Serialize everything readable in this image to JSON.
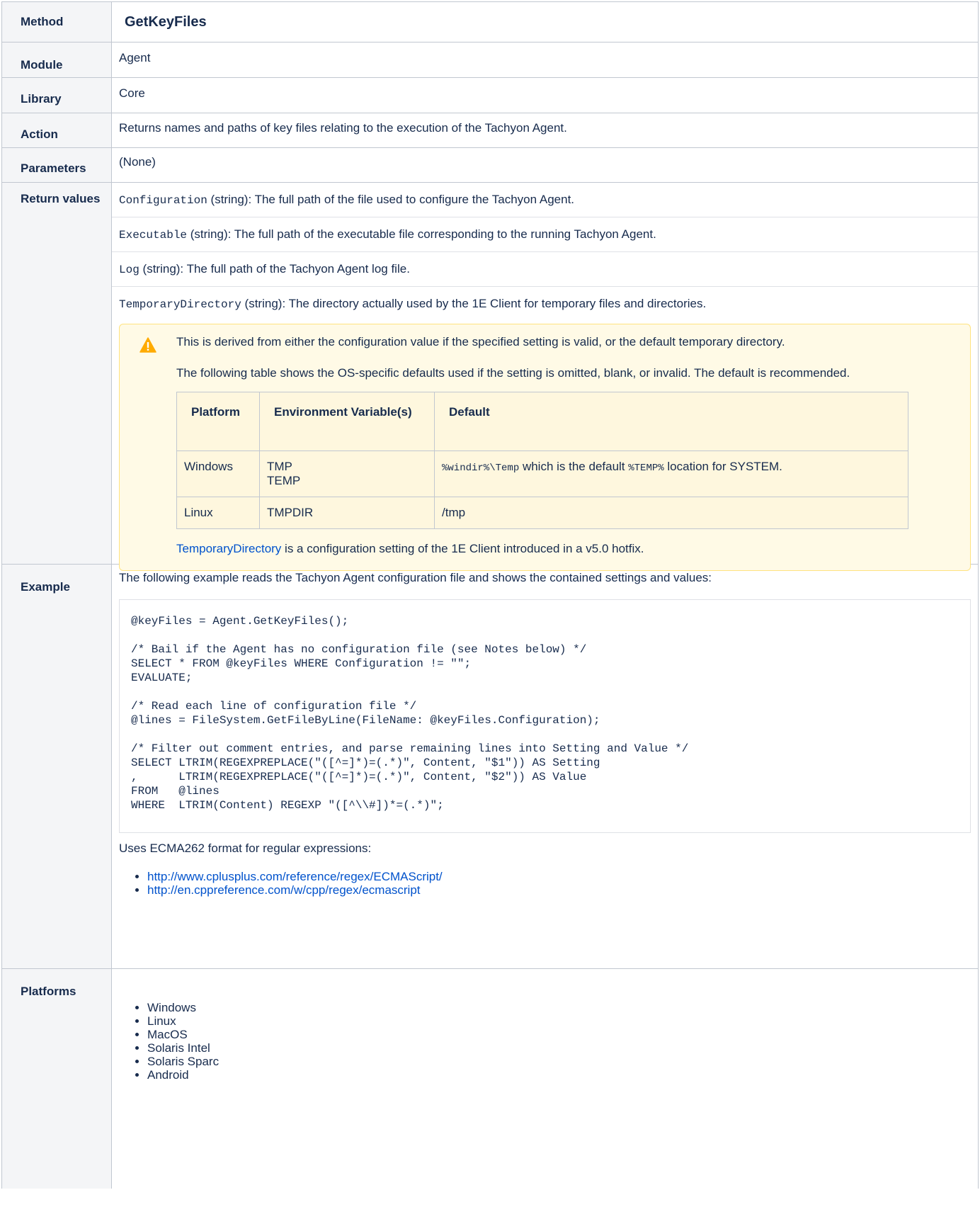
{
  "method": {
    "label": "Method",
    "value": "GetKeyFiles"
  },
  "module": {
    "label": "Module",
    "value": "Agent"
  },
  "library": {
    "label": "Library",
    "value": "Core"
  },
  "action": {
    "label": "Action",
    "value": "Returns names and paths of key files relating to the execution of the Tachyon Agent."
  },
  "parameters": {
    "label": "Parameters",
    "value": "(None)"
  },
  "return_values": {
    "label": "Return values",
    "items": [
      {
        "name": "Configuration",
        "desc": " (string): The full path of the file used to configure the Tachyon Agent."
      },
      {
        "name": "Executable",
        "desc": " (string): The full path of the executable file corresponding to the running Tachyon Agent."
      },
      {
        "name": "Log",
        "desc": " (string): The full path of the Tachyon Agent log file."
      },
      {
        "name": "TemporaryDirectory",
        "desc": " (string): The directory actually used by the 1E Client for temporary files and directories."
      }
    ],
    "warning": {
      "line1": "This is derived from either the configuration value if the specified setting is valid, or the default temporary directory.",
      "line2": "The following table shows the OS-specific defaults used if the setting is omitted, blank, or invalid. The default is recommended.",
      "table_headers": [
        "Platform",
        "Environment Variable(s)",
        "Default"
      ],
      "rows": [
        {
          "platform": "Windows",
          "env1": "TMP",
          "env2": "TEMP",
          "def_code1": "%windir%\\Temp",
          "def_text1": " which is the default ",
          "def_code2": "%TEMP%",
          "def_text2": " location for SYSTEM."
        },
        {
          "platform": "Linux",
          "env1": "TMPDIR",
          "def": "/tmp"
        }
      ],
      "link_text": "TemporaryDirectory",
      "footer_text": " is a configuration setting of the 1E Client introduced in a v5.0 hotfix."
    }
  },
  "example": {
    "label": "Example",
    "intro": "The following example reads the Tachyon Agent configuration file and shows the contained settings and values:",
    "code": "@keyFiles = Agent.GetKeyFiles();\n\n/* Bail if the Agent has no configuration file (see Notes below) */\nSELECT * FROM @keyFiles WHERE Configuration != \"\";\nEVALUATE;\n\n/* Read each line of configuration file */\n@lines = FileSystem.GetFileByLine(FileName: @keyFiles.Configuration);\n\n/* Filter out comment entries, and parse remaining lines into Setting and Value */\nSELECT LTRIM(REGEXPREPLACE(\"([^=]*)=(.*)\", Content, \"$1\")) AS Setting\n,      LTRIM(REGEXPREPLACE(\"([^=]*)=(.*)\", Content, \"$2\")) AS Value\nFROM   @lines\nWHERE  LTRIM(Content) REGEXP \"([^\\\\#])*=(.*)\";",
    "regex_note": "Uses ECMA262 format for regular expressions:",
    "links": [
      "http://www.cplusplus.com/reference/regex/ECMAScript/",
      "http://en.cppreference.com/w/cpp/regex/ecmascript"
    ]
  },
  "platforms": {
    "label": "Platforms",
    "items": [
      "Windows",
      "Linux",
      "MacOS",
      "Solaris Intel",
      "Solaris Sparc",
      "Android"
    ]
  },
  "colors": {
    "header_bg": "#f4f5f7",
    "border": "#c1c7d0",
    "link": "#0052cc",
    "warning_bg": "#fffae6",
    "warning_border": "#ffe380",
    "warning_icon": "#ffab00"
  }
}
